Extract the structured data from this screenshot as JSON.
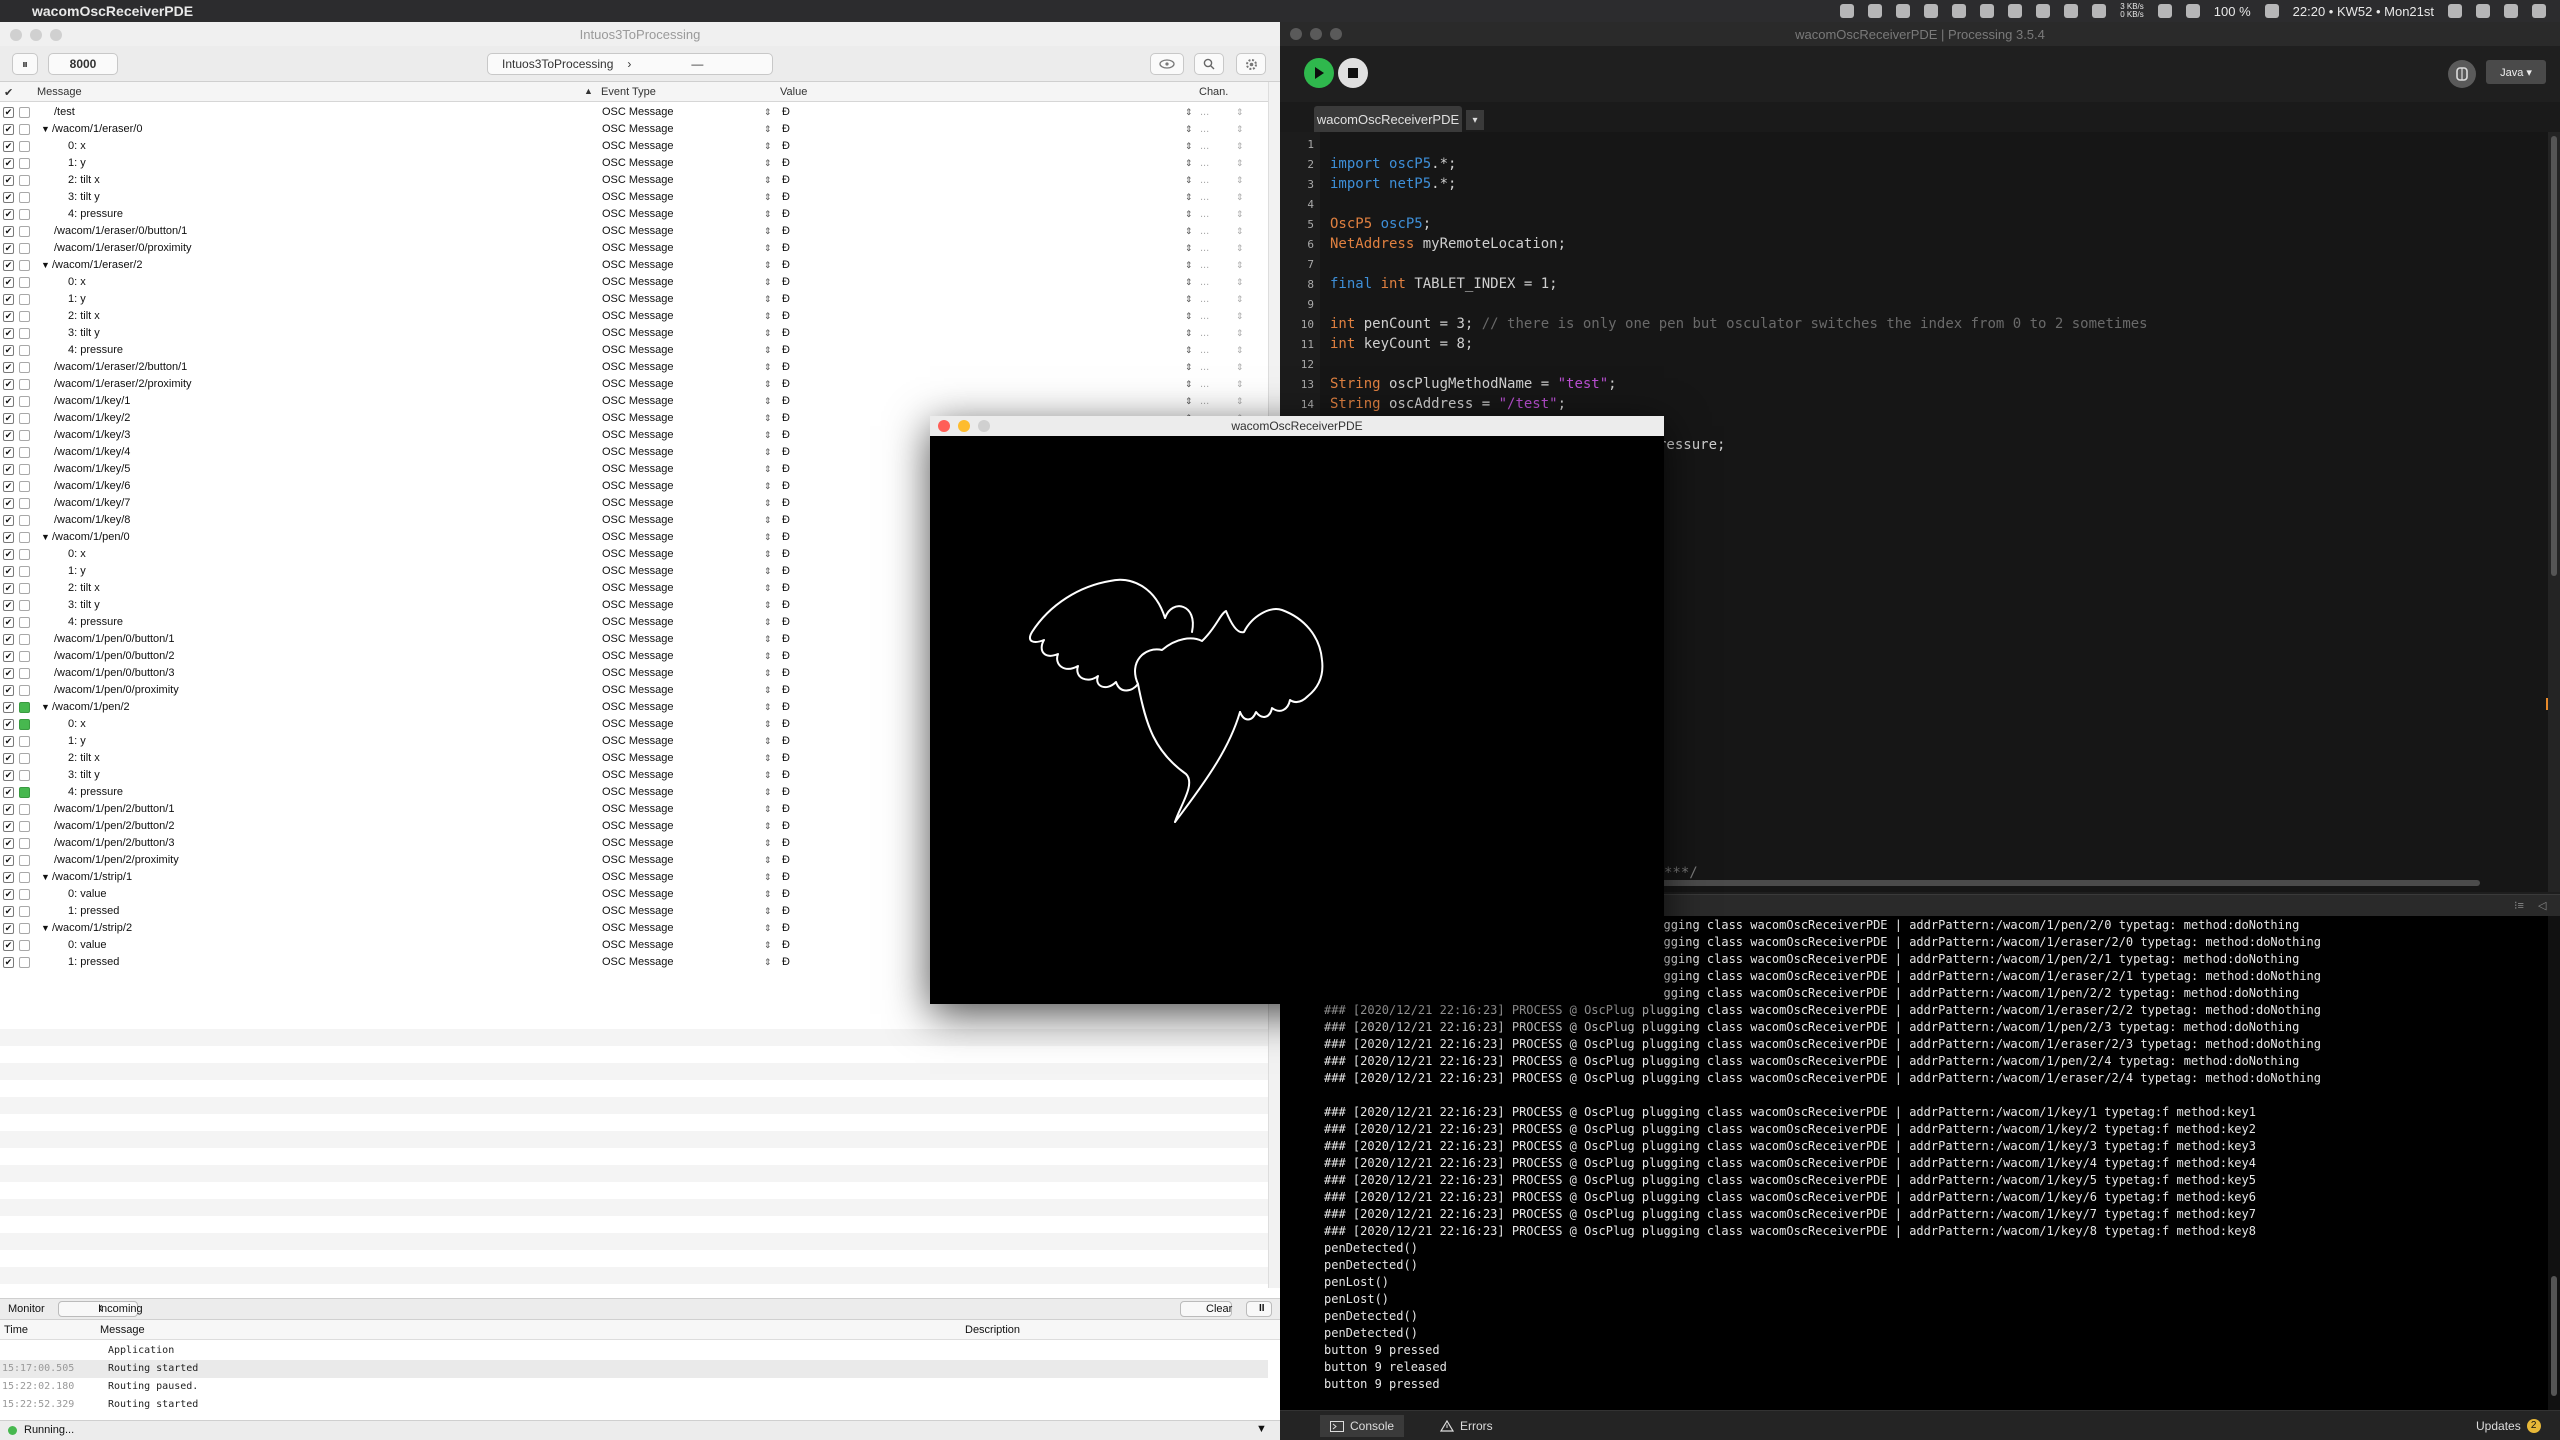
{
  "menubar": {
    "app_name": "wacomOscReceiverPDE",
    "net_up": "3 KB/s",
    "net_down": "0 KB/s",
    "battery": "100 %",
    "clock": "22:20 • KW52 • Mon21st"
  },
  "osc": {
    "window_title": "Intuos3ToProcessing",
    "port": "8000",
    "document_button": "Intuos3ToProcessing",
    "document_chevron": "›",
    "dash": "—",
    "pause_icon": "⏸",
    "columns": {
      "check": "✔",
      "message": "Message",
      "event": "Event Type",
      "value": "Value",
      "channel": "Chan."
    },
    "rows": [
      {
        "indent": 0,
        "tri": "",
        "label": "/test",
        "event": "OSC Message",
        "value": "Ð",
        "act": false
      },
      {
        "indent": 0,
        "tri": "▼",
        "label": "/wacom/1/eraser/0",
        "event": "OSC Message",
        "value": "Ð",
        "act": false
      },
      {
        "indent": 1,
        "tri": "",
        "label": "0:  x",
        "event": "OSC Message",
        "value": "Ð",
        "act": false
      },
      {
        "indent": 1,
        "tri": "",
        "label": "1:  y",
        "event": "OSC Message",
        "value": "Ð",
        "act": false
      },
      {
        "indent": 1,
        "tri": "",
        "label": "2:  tilt x",
        "event": "OSC Message",
        "value": "Ð",
        "act": false
      },
      {
        "indent": 1,
        "tri": "",
        "label": "3:  tilt y",
        "event": "OSC Message",
        "value": "Ð",
        "act": false
      },
      {
        "indent": 1,
        "tri": "",
        "label": "4:  pressure",
        "event": "OSC Message",
        "value": "Ð",
        "act": false
      },
      {
        "indent": 0,
        "tri": "",
        "label": "/wacom/1/eraser/0/button/1",
        "event": "OSC Message",
        "value": "Ð",
        "act": false
      },
      {
        "indent": 0,
        "tri": "",
        "label": "/wacom/1/eraser/0/proximity",
        "event": "OSC Message",
        "value": "Ð",
        "act": false
      },
      {
        "indent": 0,
        "tri": "▼",
        "label": "/wacom/1/eraser/2",
        "event": "OSC Message",
        "value": "Ð",
        "act": false
      },
      {
        "indent": 1,
        "tri": "",
        "label": "0:  x",
        "event": "OSC Message",
        "value": "Ð",
        "act": false
      },
      {
        "indent": 1,
        "tri": "",
        "label": "1:  y",
        "event": "OSC Message",
        "value": "Ð",
        "act": false
      },
      {
        "indent": 1,
        "tri": "",
        "label": "2:  tilt x",
        "event": "OSC Message",
        "value": "Ð",
        "act": false
      },
      {
        "indent": 1,
        "tri": "",
        "label": "3:  tilt y",
        "event": "OSC Message",
        "value": "Ð",
        "act": false
      },
      {
        "indent": 1,
        "tri": "",
        "label": "4:  pressure",
        "event": "OSC Message",
        "value": "Ð",
        "act": false
      },
      {
        "indent": 0,
        "tri": "",
        "label": "/wacom/1/eraser/2/button/1",
        "event": "OSC Message",
        "value": "Ð",
        "act": false
      },
      {
        "indent": 0,
        "tri": "",
        "label": "/wacom/1/eraser/2/proximity",
        "event": "OSC Message",
        "value": "Ð",
        "act": false
      },
      {
        "indent": 0,
        "tri": "",
        "label": "/wacom/1/key/1",
        "event": "OSC Message",
        "value": "Ð",
        "act": false
      },
      {
        "indent": 0,
        "tri": "",
        "label": "/wacom/1/key/2",
        "event": "OSC Message",
        "value": "Ð",
        "act": false
      },
      {
        "indent": 0,
        "tri": "",
        "label": "/wacom/1/key/3",
        "event": "OSC Message",
        "value": "Ð",
        "act": false
      },
      {
        "indent": 0,
        "tri": "",
        "label": "/wacom/1/key/4",
        "event": "OSC Message",
        "value": "Ð",
        "act": false
      },
      {
        "indent": 0,
        "tri": "",
        "label": "/wacom/1/key/5",
        "event": "OSC Message",
        "value": "Ð",
        "act": false
      },
      {
        "indent": 0,
        "tri": "",
        "label": "/wacom/1/key/6",
        "event": "OSC Message",
        "value": "Ð",
        "act": false
      },
      {
        "indent": 0,
        "tri": "",
        "label": "/wacom/1/key/7",
        "event": "OSC Message",
        "value": "Ð",
        "act": false
      },
      {
        "indent": 0,
        "tri": "",
        "label": "/wacom/1/key/8",
        "event": "OSC Message",
        "value": "Ð",
        "act": false
      },
      {
        "indent": 0,
        "tri": "▼",
        "label": "/wacom/1/pen/0",
        "event": "OSC Message",
        "value": "Ð",
        "act": false
      },
      {
        "indent": 1,
        "tri": "",
        "label": "0:  x",
        "event": "OSC Message",
        "value": "Ð",
        "act": false
      },
      {
        "indent": 1,
        "tri": "",
        "label": "1:  y",
        "event": "OSC Message",
        "value": "Ð",
        "act": false
      },
      {
        "indent": 1,
        "tri": "",
        "label": "2:  tilt x",
        "event": "OSC Message",
        "value": "Ð",
        "act": false
      },
      {
        "indent": 1,
        "tri": "",
        "label": "3:  tilt y",
        "event": "OSC Message",
        "value": "Ð",
        "act": false
      },
      {
        "indent": 1,
        "tri": "",
        "label": "4:  pressure",
        "event": "OSC Message",
        "value": "Ð",
        "act": false
      },
      {
        "indent": 0,
        "tri": "",
        "label": "/wacom/1/pen/0/button/1",
        "event": "OSC Message",
        "value": "Ð",
        "act": false
      },
      {
        "indent": 0,
        "tri": "",
        "label": "/wacom/1/pen/0/button/2",
        "event": "OSC Message",
        "value": "Ð",
        "act": false
      },
      {
        "indent": 0,
        "tri": "",
        "label": "/wacom/1/pen/0/button/3",
        "event": "OSC Message",
        "value": "Ð",
        "act": false
      },
      {
        "indent": 0,
        "tri": "",
        "label": "/wacom/1/pen/0/proximity",
        "event": "OSC Message",
        "value": "Ð",
        "act": false
      },
      {
        "indent": 0,
        "tri": "▼",
        "label": "/wacom/1/pen/2",
        "event": "OSC Message",
        "value": "Ð",
        "act": true
      },
      {
        "indent": 1,
        "tri": "",
        "label": "0:  x",
        "event": "OSC Message",
        "value": "Ð",
        "act": true
      },
      {
        "indent": 1,
        "tri": "",
        "label": "1:  y",
        "event": "OSC Message",
        "value": "Ð",
        "act": false
      },
      {
        "indent": 1,
        "tri": "",
        "label": "2:  tilt x",
        "event": "OSC Message",
        "value": "Ð",
        "act": false
      },
      {
        "indent": 1,
        "tri": "",
        "label": "3:  tilt y",
        "event": "OSC Message",
        "value": "Ð",
        "act": false
      },
      {
        "indent": 1,
        "tri": "",
        "label": "4:  pressure",
        "event": "OSC Message",
        "value": "Ð",
        "act": true
      },
      {
        "indent": 0,
        "tri": "",
        "label": "/wacom/1/pen/2/button/1",
        "event": "OSC Message",
        "value": "Ð",
        "act": false
      },
      {
        "indent": 0,
        "tri": "",
        "label": "/wacom/1/pen/2/button/2",
        "event": "OSC Message",
        "value": "Ð",
        "act": false
      },
      {
        "indent": 0,
        "tri": "",
        "label": "/wacom/1/pen/2/button/3",
        "event": "OSC Message",
        "value": "Ð",
        "act": false
      },
      {
        "indent": 0,
        "tri": "",
        "label": "/wacom/1/pen/2/proximity",
        "event": "OSC Message",
        "value": "Ð",
        "act": false
      },
      {
        "indent": 0,
        "tri": "▼",
        "label": "/wacom/1/strip/1",
        "event": "OSC Message",
        "value": "Ð",
        "act": false
      },
      {
        "indent": 1,
        "tri": "",
        "label": "0:  value",
        "event": "OSC Message",
        "value": "Ð",
        "act": false
      },
      {
        "indent": 1,
        "tri": "",
        "label": "1:  pressed",
        "event": "OSC Message",
        "value": "Ð",
        "act": false
      },
      {
        "indent": 0,
        "tri": "▼",
        "label": "/wacom/1/strip/2",
        "event": "OSC Message",
        "value": "Ð",
        "act": false
      },
      {
        "indent": 1,
        "tri": "",
        "label": "0:  value",
        "event": "OSC Message",
        "value": "Ð",
        "act": false
      },
      {
        "indent": 1,
        "tri": "",
        "label": "1:  pressed",
        "event": "OSC Message",
        "value": "Ð",
        "act": false
      }
    ],
    "monitor": {
      "label": "Monitor",
      "mode": "Incoming",
      "clear": "Clear",
      "pause": "II",
      "columns": {
        "time": "Time",
        "message": "Message",
        "description": "Description"
      },
      "rows": [
        {
          "time": "",
          "message": "Application"
        },
        {
          "time": "15:17:00.505",
          "message": "Routing started"
        },
        {
          "time": "15:22:02.180",
          "message": "Routing paused."
        },
        {
          "time": "15:22:52.329",
          "message": "Routing started"
        }
      ]
    },
    "status": "Running...",
    "colors": {
      "active_green": "#47b84f"
    }
  },
  "pde": {
    "window_title": "wacomOscReceiverPDE | Processing 3.5.4",
    "mode": "Java ▾",
    "tab": "wacomOscReceiverPDE",
    "tab_arrow": "▾",
    "code": [
      {
        "n": "1",
        "t": ""
      },
      {
        "n": "2",
        "t": "import oscP5.*;"
      },
      {
        "n": "3",
        "t": "import netP5.*;"
      },
      {
        "n": "4",
        "t": ""
      },
      {
        "n": "5",
        "t": "OscP5 oscP5;"
      },
      {
        "n": "6",
        "t": "NetAddress myRemoteLocation;"
      },
      {
        "n": "7",
        "t": ""
      },
      {
        "n": "8",
        "t": "final int TABLET_INDEX = 1;"
      },
      {
        "n": "9",
        "t": ""
      },
      {
        "n": "10",
        "t": "int penCount = 3; // there is only one pen but osculator switches the index from 0 to 2 sometimes"
      },
      {
        "n": "11",
        "t": "int keyCount = 8;"
      },
      {
        "n": "12",
        "t": ""
      },
      {
        "n": "13",
        "t": "String oscPlugMethodName = \"test\";"
      },
      {
        "n": "14",
        "t": "String oscAddress = \"/test\";"
      }
    ],
    "code_fragment_1": "ressure;",
    "code_fragment_2": "***/",
    "console": [
      "                                            plugging class wacomOscReceiverPDE | addrPattern:/wacom/1/pen/2/0 typetag: method:doNothing",
      "                                            plugging class wacomOscReceiverPDE | addrPattern:/wacom/1/eraser/2/0 typetag: method:doNothing",
      "                                            plugging class wacomOscReceiverPDE | addrPattern:/wacom/1/pen/2/1 typetag: method:doNothing",
      "                                            plugging class wacomOscReceiverPDE | addrPattern:/wacom/1/eraser/2/1 typetag: method:doNothing",
      "                                            plugging class wacomOscReceiverPDE | addrPattern:/wacom/1/pen/2/2 typetag: method:doNothing",
      "### [2020/12/21 22:16:23] PROCESS @ OscPlug plugging class wacomOscReceiverPDE | addrPattern:/wacom/1/eraser/2/2 typetag: method:doNothing",
      "### [2020/12/21 22:16:23] PROCESS @ OscPlug plugging class wacomOscReceiverPDE | addrPattern:/wacom/1/pen/2/3 typetag: method:doNothing",
      "### [2020/12/21 22:16:23] PROCESS @ OscPlug plugging class wacomOscReceiverPDE | addrPattern:/wacom/1/eraser/2/3 typetag: method:doNothing",
      "### [2020/12/21 22:16:23] PROCESS @ OscPlug plugging class wacomOscReceiverPDE | addrPattern:/wacom/1/pen/2/4 typetag: method:doNothing",
      "### [2020/12/21 22:16:23] PROCESS @ OscPlug plugging class wacomOscReceiverPDE | addrPattern:/wacom/1/eraser/2/4 typetag: method:doNothing",
      "",
      "### [2020/12/21 22:16:23] PROCESS @ OscPlug plugging class wacomOscReceiverPDE | addrPattern:/wacom/1/key/1 typetag:f method:key1",
      "### [2020/12/21 22:16:23] PROCESS @ OscPlug plugging class wacomOscReceiverPDE | addrPattern:/wacom/1/key/2 typetag:f method:key2",
      "### [2020/12/21 22:16:23] PROCESS @ OscPlug plugging class wacomOscReceiverPDE | addrPattern:/wacom/1/key/3 typetag:f method:key3",
      "### [2020/12/21 22:16:23] PROCESS @ OscPlug plugging class wacomOscReceiverPDE | addrPattern:/wacom/1/key/4 typetag:f method:key4",
      "### [2020/12/21 22:16:23] PROCESS @ OscPlug plugging class wacomOscReceiverPDE | addrPattern:/wacom/1/key/5 typetag:f method:key5",
      "### [2020/12/21 22:16:23] PROCESS @ OscPlug plugging class wacomOscReceiverPDE | addrPattern:/wacom/1/key/6 typetag:f method:key6",
      "### [2020/12/21 22:16:23] PROCESS @ OscPlug plugging class wacomOscReceiverPDE | addrPattern:/wacom/1/key/7 typetag:f method:key7",
      "### [2020/12/21 22:16:23] PROCESS @ OscPlug plugging class wacomOscReceiverPDE | addrPattern:/wacom/1/key/8 typetag:f method:key8",
      "penDetected()",
      "penDetected()",
      "penLost()",
      "penLost()",
      "penDetected()",
      "penDetected()",
      "button 9 pressed",
      "button 9 released",
      "button 9 pressed"
    ],
    "bottom_tabs": {
      "console": "Console",
      "errors": "Errors",
      "updates": "Updates",
      "updates_count": "2"
    },
    "colors": {
      "keyword": "#3e8fd8",
      "type": "#e08040",
      "string": "#b94fd1",
      "run_green": "#2fb84d"
    }
  },
  "sketch": {
    "window_title": "wacomOscReceiverPDE"
  }
}
